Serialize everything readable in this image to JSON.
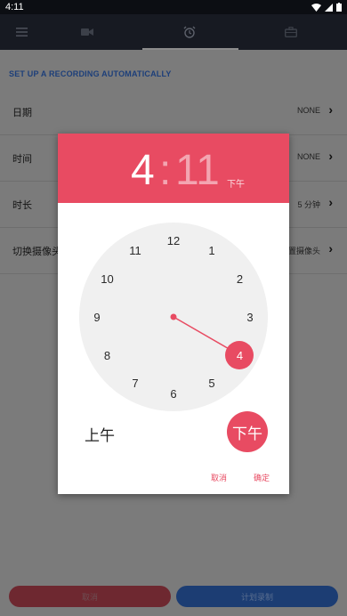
{
  "status_bar": {
    "time": "4:11"
  },
  "app_bar": {
    "icons": [
      "menu-icon",
      "video-camera-icon",
      "alarm-clock-icon",
      "briefcase-icon"
    ]
  },
  "content": {
    "section_title": "SET UP A RECORDING AUTOMATICALLY",
    "rows": [
      {
        "label": "日期",
        "value": "NONE"
      },
      {
        "label": "时间",
        "value": "NONE"
      },
      {
        "label": "时长",
        "value": "5 分钟"
      },
      {
        "label": "切换摄像头",
        "value": "后置摄像头"
      }
    ],
    "cancel_button": "取消",
    "schedule_button": "计划录制"
  },
  "time_picker": {
    "hour": "4",
    "separator": ":",
    "minute": "11",
    "period_header": "下午",
    "clock_numbers": [
      "12",
      "1",
      "2",
      "3",
      "4",
      "5",
      "6",
      "7",
      "8",
      "9",
      "10",
      "11"
    ],
    "selected_hour": 4,
    "am_label": "上午",
    "pm_label": "下午",
    "selected_period": "pm",
    "cancel": "取消",
    "ok": "确定",
    "accent_color": "#e84b62"
  }
}
